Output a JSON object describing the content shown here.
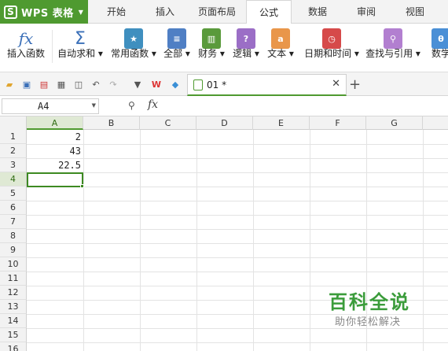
{
  "app": {
    "logo": "S",
    "name": "WPS 表格"
  },
  "tabs": [
    "开始",
    "插入",
    "页面布局",
    "公式",
    "数据",
    "审阅",
    "视图"
  ],
  "active_tab": "公式",
  "ribbon": {
    "insert_function": "插入函数",
    "autosum": "自动求和",
    "common_functions": "常用函数",
    "all": "全部",
    "finance": "财务",
    "logic": "逻辑",
    "text": "文本",
    "datetime": "日期和时间",
    "lookup": "查找与引用",
    "math": "数学"
  },
  "document_tab": {
    "name": "01 *"
  },
  "formula_bar": {
    "name_box": "A4",
    "fx": "fx",
    "value": ""
  },
  "columns": [
    "A",
    "B",
    "C",
    "D",
    "E",
    "F",
    "G"
  ],
  "rows": [
    "1",
    "2",
    "3",
    "4",
    "5",
    "6",
    "7",
    "8",
    "9",
    "10",
    "11",
    "12",
    "13",
    "14",
    "15",
    "16"
  ],
  "cells": {
    "A1": "2",
    "A2": "43",
    "A3": "22.5"
  },
  "selected_cell": "A4",
  "watermark": {
    "title": "百科全说",
    "subtitle": "助你轻松解决"
  },
  "colors": {
    "accent": "#4f9a30",
    "selection": "#3d8a22",
    "watermark": "#3b9c3b"
  }
}
